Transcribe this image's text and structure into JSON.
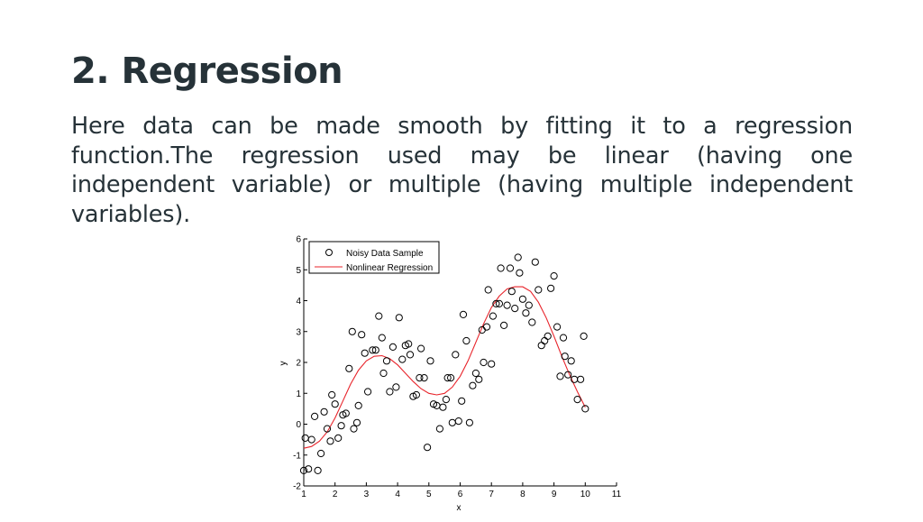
{
  "slide": {
    "title": "2. Regression",
    "body": "Here data can be made smooth by fitting it to a regression function.The regression used may be linear (having one independent variable) or multiple (having multiple independent variables)."
  },
  "chart_data": {
    "type": "scatter",
    "title": "",
    "xlabel": "x",
    "ylabel": "y",
    "xlim": [
      1,
      11
    ],
    "ylim": [
      -2,
      6
    ],
    "xticks": [
      1,
      2,
      3,
      4,
      5,
      6,
      7,
      8,
      9,
      10,
      11
    ],
    "yticks": [
      -2,
      -1,
      0,
      1,
      2,
      3,
      4,
      5,
      6
    ],
    "grid": false,
    "legend": {
      "placement": "top-left",
      "entries": [
        "Noisy Data Sample",
        "Nonlinear Regression"
      ]
    },
    "colors": {
      "markers": "#000000",
      "regression": "#e8242b",
      "axes": "#000000"
    },
    "series": [
      {
        "name": "Noisy Data Sample",
        "kind": "markers",
        "points": [
          [
            1.0,
            -1.5
          ],
          [
            1.05,
            -0.45
          ],
          [
            1.15,
            -1.45
          ],
          [
            1.25,
            -0.5
          ],
          [
            1.35,
            0.25
          ],
          [
            1.45,
            -1.5
          ],
          [
            1.55,
            -0.95
          ],
          [
            1.65,
            0.4
          ],
          [
            1.75,
            -0.15
          ],
          [
            1.85,
            -0.55
          ],
          [
            1.9,
            0.95
          ],
          [
            2.0,
            0.65
          ],
          [
            2.1,
            -0.45
          ],
          [
            2.2,
            -0.05
          ],
          [
            2.25,
            0.3
          ],
          [
            2.35,
            0.35
          ],
          [
            2.45,
            1.8
          ],
          [
            2.55,
            3.0
          ],
          [
            2.6,
            -0.15
          ],
          [
            2.7,
            0.05
          ],
          [
            2.75,
            0.6
          ],
          [
            2.85,
            2.9
          ],
          [
            2.95,
            2.3
          ],
          [
            3.05,
            1.05
          ],
          [
            3.2,
            2.4
          ],
          [
            3.3,
            2.4
          ],
          [
            3.4,
            3.5
          ],
          [
            3.5,
            2.8
          ],
          [
            3.55,
            1.65
          ],
          [
            3.65,
            2.05
          ],
          [
            3.75,
            1.05
          ],
          [
            3.85,
            2.5
          ],
          [
            3.95,
            1.2
          ],
          [
            4.05,
            3.45
          ],
          [
            4.15,
            2.1
          ],
          [
            4.25,
            2.55
          ],
          [
            4.35,
            2.6
          ],
          [
            4.4,
            2.25
          ],
          [
            4.5,
            0.9
          ],
          [
            4.6,
            0.95
          ],
          [
            4.7,
            1.5
          ],
          [
            4.75,
            2.45
          ],
          [
            4.85,
            1.5
          ],
          [
            4.95,
            -0.75
          ],
          [
            5.05,
            2.05
          ],
          [
            5.15,
            0.65
          ],
          [
            5.25,
            0.6
          ],
          [
            5.35,
            -0.15
          ],
          [
            5.45,
            0.55
          ],
          [
            5.55,
            0.8
          ],
          [
            5.6,
            1.5
          ],
          [
            5.7,
            1.5
          ],
          [
            5.75,
            0.05
          ],
          [
            5.85,
            2.25
          ],
          [
            5.95,
            0.1
          ],
          [
            6.05,
            0.75
          ],
          [
            6.1,
            3.55
          ],
          [
            6.2,
            2.7
          ],
          [
            6.3,
            0.05
          ],
          [
            6.4,
            1.25
          ],
          [
            6.5,
            1.65
          ],
          [
            6.6,
            1.45
          ],
          [
            6.7,
            3.05
          ],
          [
            6.75,
            2.0
          ],
          [
            6.85,
            3.15
          ],
          [
            6.9,
            4.35
          ],
          [
            7.0,
            1.95
          ],
          [
            7.05,
            3.5
          ],
          [
            7.15,
            3.9
          ],
          [
            7.25,
            3.9
          ],
          [
            7.3,
            5.05
          ],
          [
            7.4,
            3.2
          ],
          [
            7.5,
            3.85
          ],
          [
            7.6,
            5.05
          ],
          [
            7.65,
            4.3
          ],
          [
            7.75,
            3.75
          ],
          [
            7.85,
            5.4
          ],
          [
            7.9,
            4.9
          ],
          [
            8.0,
            4.05
          ],
          [
            8.1,
            3.6
          ],
          [
            8.2,
            3.85
          ],
          [
            8.3,
            3.3
          ],
          [
            8.4,
            5.25
          ],
          [
            8.5,
            4.35
          ],
          [
            8.6,
            2.55
          ],
          [
            8.7,
            2.7
          ],
          [
            8.8,
            2.85
          ],
          [
            8.9,
            4.4
          ],
          [
            9.0,
            4.8
          ],
          [
            9.1,
            3.15
          ],
          [
            9.2,
            1.55
          ],
          [
            9.3,
            2.8
          ],
          [
            9.35,
            2.2
          ],
          [
            9.45,
            1.6
          ],
          [
            9.55,
            2.05
          ],
          [
            9.65,
            1.45
          ],
          [
            9.75,
            0.8
          ],
          [
            9.85,
            1.45
          ],
          [
            9.95,
            2.85
          ],
          [
            10.0,
            0.5
          ]
        ]
      },
      {
        "name": "Nonlinear Regression",
        "kind": "line",
        "points": [
          [
            1.0,
            -0.78
          ],
          [
            1.25,
            -0.72
          ],
          [
            1.5,
            -0.55
          ],
          [
            1.75,
            -0.25
          ],
          [
            2.0,
            0.2
          ],
          [
            2.25,
            0.75
          ],
          [
            2.5,
            1.3
          ],
          [
            2.75,
            1.75
          ],
          [
            3.0,
            2.05
          ],
          [
            3.25,
            2.2
          ],
          [
            3.5,
            2.22
          ],
          [
            3.75,
            2.12
          ],
          [
            4.0,
            1.92
          ],
          [
            4.25,
            1.65
          ],
          [
            4.5,
            1.38
          ],
          [
            4.75,
            1.15
          ],
          [
            5.0,
            1.0
          ],
          [
            5.25,
            0.95
          ],
          [
            5.5,
            1.0
          ],
          [
            5.75,
            1.2
          ],
          [
            6.0,
            1.55
          ],
          [
            6.25,
            2.05
          ],
          [
            6.5,
            2.65
          ],
          [
            6.75,
            3.25
          ],
          [
            7.0,
            3.78
          ],
          [
            7.25,
            4.15
          ],
          [
            7.5,
            4.38
          ],
          [
            7.75,
            4.45
          ],
          [
            8.0,
            4.45
          ],
          [
            8.25,
            4.3
          ],
          [
            8.5,
            3.95
          ],
          [
            8.75,
            3.45
          ],
          [
            9.0,
            2.85
          ],
          [
            9.25,
            2.2
          ],
          [
            9.5,
            1.6
          ],
          [
            9.75,
            1.05
          ],
          [
            10.0,
            0.55
          ]
        ]
      }
    ]
  }
}
